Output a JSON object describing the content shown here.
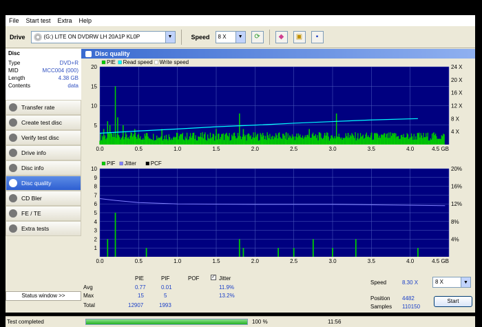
{
  "menu": [
    "File",
    "Start test",
    "Extra",
    "Help"
  ],
  "toolbar": {
    "drive_label": "Drive",
    "drive_value": "(G:)  LITE ON DVDRW LH 20A1P KL0P",
    "speed_label": "Speed",
    "speed_value": "8 X"
  },
  "disc": {
    "header": "Disc",
    "rows": [
      {
        "k": "Type",
        "v": "DVD+R"
      },
      {
        "k": "MID",
        "v": "MCC004 (000)"
      },
      {
        "k": "Length",
        "v": "4.38 GB"
      },
      {
        "k": "Contents",
        "v": "data"
      }
    ]
  },
  "nav": [
    {
      "label": "Transfer rate",
      "active": false
    },
    {
      "label": "Create test disc",
      "active": false
    },
    {
      "label": "Verify test disc",
      "active": false
    },
    {
      "label": "Drive info",
      "active": false
    },
    {
      "label": "Disc info",
      "active": false
    },
    {
      "label": "Disc quality",
      "active": true
    },
    {
      "label": "CD Bler",
      "active": false
    },
    {
      "label": "FE / TE",
      "active": false
    },
    {
      "label": "Extra tests",
      "active": false
    }
  ],
  "status_window_label": "Status window >>",
  "panel_title": "Disc quality",
  "colors": {
    "pe": "#00cc00",
    "read": "#00ffff",
    "jitter": "#8080ff",
    "plot_bg": "#000080",
    "pif": "#00cc00",
    "grid": "#5060c0"
  },
  "chart_data": [
    {
      "type": "bar",
      "legend": [
        "PIE",
        "Read speed",
        "Write speed"
      ],
      "x_ticks": [
        "0.0",
        "0.5",
        "1.0",
        "1.5",
        "2.0",
        "2.5",
        "3.0",
        "3.5",
        "4.0",
        "4.5 GB"
      ],
      "y_left_ticks": [
        "20",
        "15",
        "10",
        "5"
      ],
      "y_right_ticks": [
        "24 X",
        "20 X",
        "16 X",
        "12 X",
        "8 X",
        "4 X"
      ],
      "xlim": [
        0,
        4.5
      ],
      "ylim_left": [
        0,
        20
      ],
      "ylim_right": [
        0,
        24
      ],
      "pie_spikes": [
        {
          "x": 0.05,
          "y": 4
        },
        {
          "x": 0.1,
          "y": 6
        },
        {
          "x": 0.13,
          "y": 5
        },
        {
          "x": 0.2,
          "y": 15
        },
        {
          "x": 0.23,
          "y": 7
        },
        {
          "x": 0.3,
          "y": 5
        },
        {
          "x": 0.45,
          "y": 4
        },
        {
          "x": 0.6,
          "y": 3
        },
        {
          "x": 0.8,
          "y": 4
        },
        {
          "x": 1.0,
          "y": 3
        },
        {
          "x": 1.2,
          "y": 3
        },
        {
          "x": 1.5,
          "y": 4
        },
        {
          "x": 1.8,
          "y": 8
        },
        {
          "x": 1.85,
          "y": 4
        },
        {
          "x": 2.1,
          "y": 3
        },
        {
          "x": 2.4,
          "y": 3
        },
        {
          "x": 2.7,
          "y": 4
        },
        {
          "x": 2.9,
          "y": 3
        },
        {
          "x": 3.05,
          "y": 8
        },
        {
          "x": 3.2,
          "y": 3
        },
        {
          "x": 3.5,
          "y": 3
        },
        {
          "x": 3.8,
          "y": 3
        },
        {
          "x": 4.1,
          "y": 3
        },
        {
          "x": 4.3,
          "y": 3
        }
      ],
      "read_speed": [
        [
          0.0,
          3.5
        ],
        [
          0.5,
          4.2
        ],
        [
          1.0,
          4.8
        ],
        [
          1.5,
          5.5
        ],
        [
          2.0,
          6.0
        ],
        [
          2.5,
          6.6
        ],
        [
          3.0,
          7.1
        ],
        [
          3.5,
          7.6
        ],
        [
          4.1,
          8.0
        ]
      ]
    },
    {
      "type": "bar",
      "legend": [
        "PIF",
        "Jitter",
        "PCF"
      ],
      "x_ticks": [
        "0.0",
        "0.5",
        "1.0",
        "1.5",
        "2.0",
        "2.5",
        "3.0",
        "3.5",
        "4.0",
        "4.5 GB"
      ],
      "y_left_ticks": [
        "10",
        "9",
        "8",
        "7",
        "6",
        "5",
        "4",
        "3",
        "2",
        "1"
      ],
      "y_right_ticks": [
        "20%",
        "16%",
        "12%",
        "8%",
        "4%"
      ],
      "xlim": [
        0,
        4.5
      ],
      "ylim_left": [
        0,
        10
      ],
      "ylim_right": [
        0,
        20
      ],
      "pif_spikes": [
        {
          "x": 0.1,
          "y": 2
        },
        {
          "x": 0.2,
          "y": 5
        },
        {
          "x": 0.6,
          "y": 1
        },
        {
          "x": 1.8,
          "y": 2
        },
        {
          "x": 1.85,
          "y": 1
        },
        {
          "x": 2.3,
          "y": 1
        },
        {
          "x": 2.5,
          "y": 1
        },
        {
          "x": 2.75,
          "y": 2
        },
        {
          "x": 3.0,
          "y": 1
        },
        {
          "x": 3.3,
          "y": 2
        },
        {
          "x": 4.1,
          "y": 1
        }
      ],
      "jitter": [
        [
          0.0,
          13.2
        ],
        [
          0.2,
          12.8
        ],
        [
          0.5,
          12.3
        ],
        [
          1.0,
          12.0
        ],
        [
          2.0,
          11.9
        ],
        [
          3.0,
          11.9
        ],
        [
          4.0,
          11.7
        ],
        [
          4.45,
          11.6
        ]
      ]
    }
  ],
  "stats": {
    "headers": [
      "PIE",
      "PIF",
      "POF",
      "Jitter"
    ],
    "rows": [
      {
        "label": "Avg",
        "pie": "0.77",
        "pif": "0.01",
        "jitter": "11.9%"
      },
      {
        "label": "Max",
        "pie": "15",
        "pif": "5",
        "jitter": "13.2%"
      },
      {
        "label": "Total",
        "pie": "12907",
        "pif": "1993",
        "jitter": ""
      }
    ],
    "speed_label": "Speed",
    "speed_value": "8.30 X",
    "speed_select": "8 X",
    "position_label": "Position",
    "position_value": "4482",
    "samples_label": "Samples",
    "samples_value": "110150",
    "start_label": "Start"
  },
  "status": {
    "text": "Test completed",
    "progress": 1.0,
    "percent_label": "100 %",
    "time": "11:56"
  }
}
